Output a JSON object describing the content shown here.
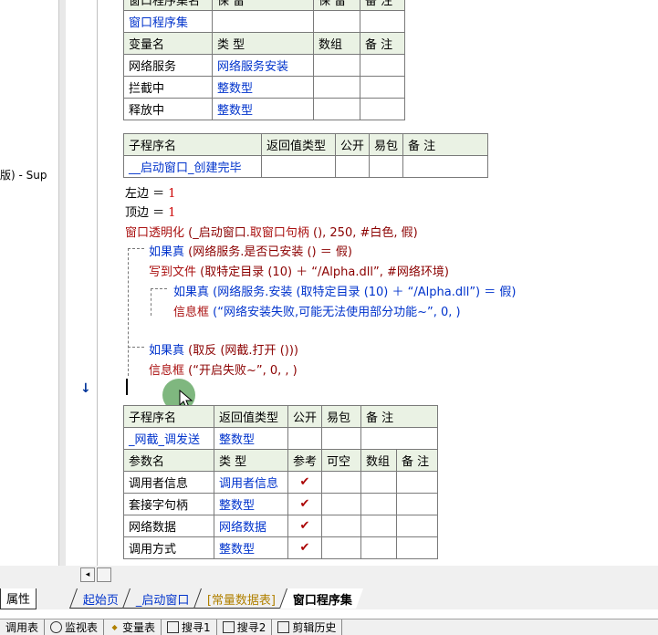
{
  "left_panel": {
    "partial_text": "版) - Sup"
  },
  "table_window": {
    "header": [
      "窗口程序集名",
      "保 留",
      "保 留",
      "备 注"
    ],
    "name_row": [
      "窗口程序集",
      "",
      "",
      ""
    ],
    "var_header": [
      "变量名",
      "类 型",
      "数组",
      "备 注"
    ],
    "vars": [
      {
        "name": "网络服务",
        "type": "网络服务安装"
      },
      {
        "name": "拦截中",
        "type": "整数型"
      },
      {
        "name": "释放中",
        "type": "整数型"
      }
    ]
  },
  "table_sub1": {
    "header": [
      "子程序名",
      "返回值类型",
      "公开",
      "易包",
      "备 注"
    ],
    "row": [
      "__启动窗口_创建完毕",
      "",
      "",
      "",
      ""
    ]
  },
  "code": {
    "line1_a": "左边",
    "line1_b": " ＝ ",
    "line1_c": "1",
    "line2_a": "顶边",
    "line2_b": " ＝ ",
    "line2_c": "1",
    "line3_fn": "窗口透明化",
    "line3_args_a": " (_启动窗口.",
    "line3_args_b": "取窗口句柄",
    "line3_args_c": " (), 250, #白色, 假)",
    "line4_kw": "如果真",
    "line4_rest": " (网络服务.是否已安装 () ＝ 假)",
    "line5_fn": "写到文件",
    "line5_rest": " (取特定目录 (10) ＋ “/Alpha.dll”, #网络环境)",
    "line6_kw": "如果真",
    "line6_rest": " (网络服务.安装 (取特定目录 (10) ＋ “/Alpha.dll”) ＝ 假)",
    "line7_fn": "信息框",
    "line7_rest": " (“网络安装失败,可能无法使用部分功能~”, 0, )",
    "line8_kw": "如果真",
    "line8_rest": " (取反 (网截.打开 ()))",
    "line9_fn": "信息框",
    "line9_rest": " (“开启失败~”, 0, , )"
  },
  "table_sub2": {
    "header": [
      "子程序名",
      "返回值类型",
      "公开",
      "易包",
      "备 注"
    ],
    "row": [
      "_网截_调发送",
      "整数型",
      "",
      "",
      ""
    ],
    "param_header": [
      "参数名",
      "类 型",
      "参考",
      "可空",
      "数组",
      "备 注"
    ],
    "params": [
      {
        "name": "调用者信息",
        "type": "调用者信息",
        "ref": "✔"
      },
      {
        "name": "套接字句柄",
        "type": "整数型",
        "ref": "✔"
      },
      {
        "name": "网络数据",
        "type": "网络数据",
        "ref": "✔"
      },
      {
        "name": "调用方式",
        "type": "整数型",
        "ref": "✔"
      }
    ]
  },
  "gutter": {
    "marker1": "»",
    "marker2": "↓"
  },
  "tabs": {
    "properties": "属性",
    "items": [
      "起始页",
      "_启动窗口",
      "[常量数据表]",
      "窗口程序集"
    ],
    "active_index": 3
  },
  "toolbar": {
    "items": [
      "调用表",
      "监视表",
      "变量表",
      "搜寻1",
      "搜寻2",
      "剪辑历史"
    ]
  },
  "colors": {
    "keyword_blue": "#0033cc",
    "function_red": "#aa1111",
    "header_green": "#eaf2e4"
  }
}
